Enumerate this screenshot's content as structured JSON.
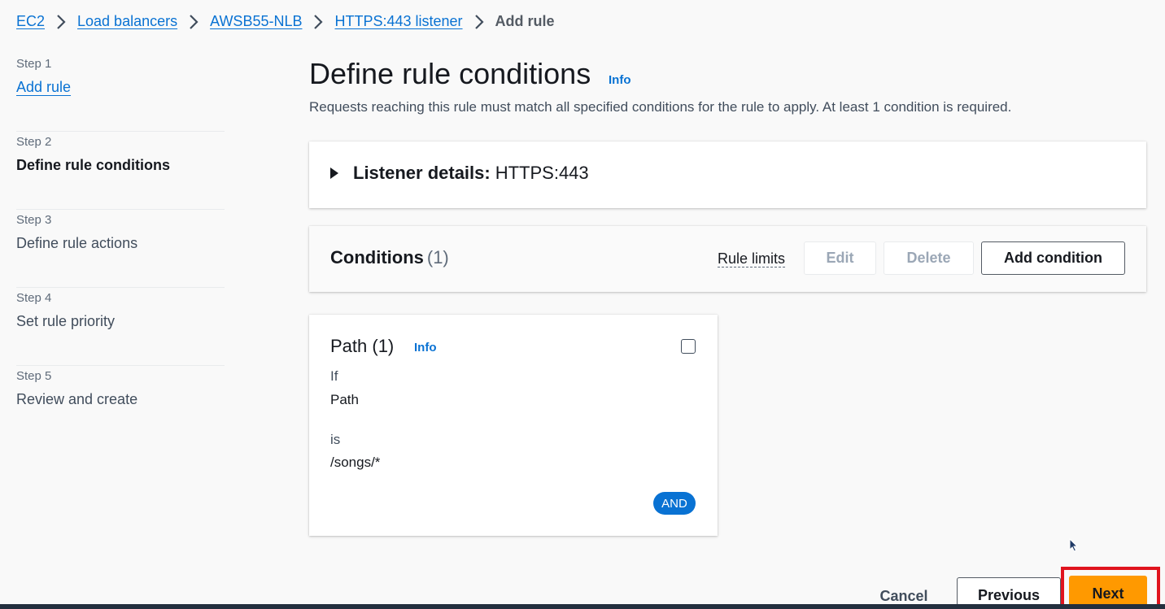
{
  "breadcrumb": {
    "items": [
      {
        "label": "EC2"
      },
      {
        "label": "Load balancers"
      },
      {
        "label": "AWSB55-NLB"
      },
      {
        "label": "HTTPS:443 listener"
      }
    ],
    "current": "Add rule"
  },
  "steps": [
    {
      "step": "Step 1",
      "title": "Add rule"
    },
    {
      "step": "Step 2",
      "title": "Define rule conditions"
    },
    {
      "step": "Step 3",
      "title": "Define rule actions"
    },
    {
      "step": "Step 4",
      "title": "Set rule priority"
    },
    {
      "step": "Step 5",
      "title": "Review and create"
    }
  ],
  "main": {
    "title": "Define rule conditions",
    "info": "Info",
    "description": "Requests reaching this rule must match all specified conditions for the rule to apply. At least 1 condition is required."
  },
  "listener": {
    "label": "Listener details:",
    "value": "HTTPS:443"
  },
  "conditions": {
    "title": "Conditions",
    "count": "(1)",
    "rule_limits": "Rule limits",
    "edit_label": "Edit",
    "delete_label": "Delete",
    "add_label": "Add condition"
  },
  "path_card": {
    "title": "Path (1)",
    "info": "Info",
    "if_label": "If",
    "field": "Path",
    "is_label": "is",
    "value": "/songs/*",
    "badge": "AND"
  },
  "footer": {
    "cancel": "Cancel",
    "previous": "Previous",
    "next": "Next"
  },
  "colors": {
    "link": "#0972d3",
    "primary_button": "#ff9900",
    "highlight": "#e0141e",
    "bottom_bar": "#232f3e"
  }
}
